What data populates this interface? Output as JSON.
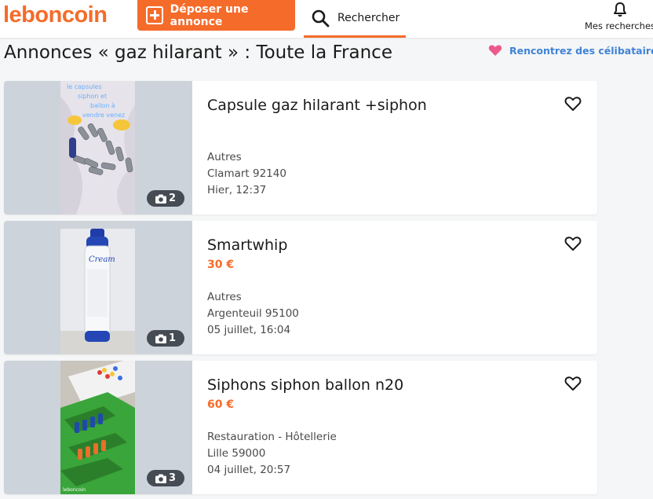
{
  "header": {
    "logo": "leboncoin",
    "post_label": "Déposer une annonce",
    "search_label": "Rechercher",
    "searches_label": "Mes recherches"
  },
  "page": {
    "title": "Annonces « gaz hilarant » : Toute la France",
    "promo": "Rencontrez des célibataires p"
  },
  "listings": [
    {
      "title": "Capsule gaz hilarant +siphon",
      "price": "",
      "category": "Autres",
      "location": "Clamart 92140",
      "date": "Hier, 12:37",
      "photo_count": "2"
    },
    {
      "title": "Smartwhip",
      "price": "30 €",
      "category": "Autres",
      "location": "Argenteuil 95100",
      "date": "05 juillet, 16:04",
      "photo_count": "1"
    },
    {
      "title": "Siphons siphon ballon n20",
      "price": "60 €",
      "category": "Restauration - Hôtellerie",
      "location": "Lille 59000",
      "date": "04 juillet, 20:57",
      "photo_count": "3"
    }
  ],
  "colors": {
    "brand": "#f56b2a",
    "link": "#4183d7",
    "heart_pink": "#ec5a8c"
  },
  "icons": [
    "plus-square-icon",
    "search-icon",
    "bell-icon",
    "heart-icon",
    "camera-icon",
    "favorite-heart-icon"
  ]
}
